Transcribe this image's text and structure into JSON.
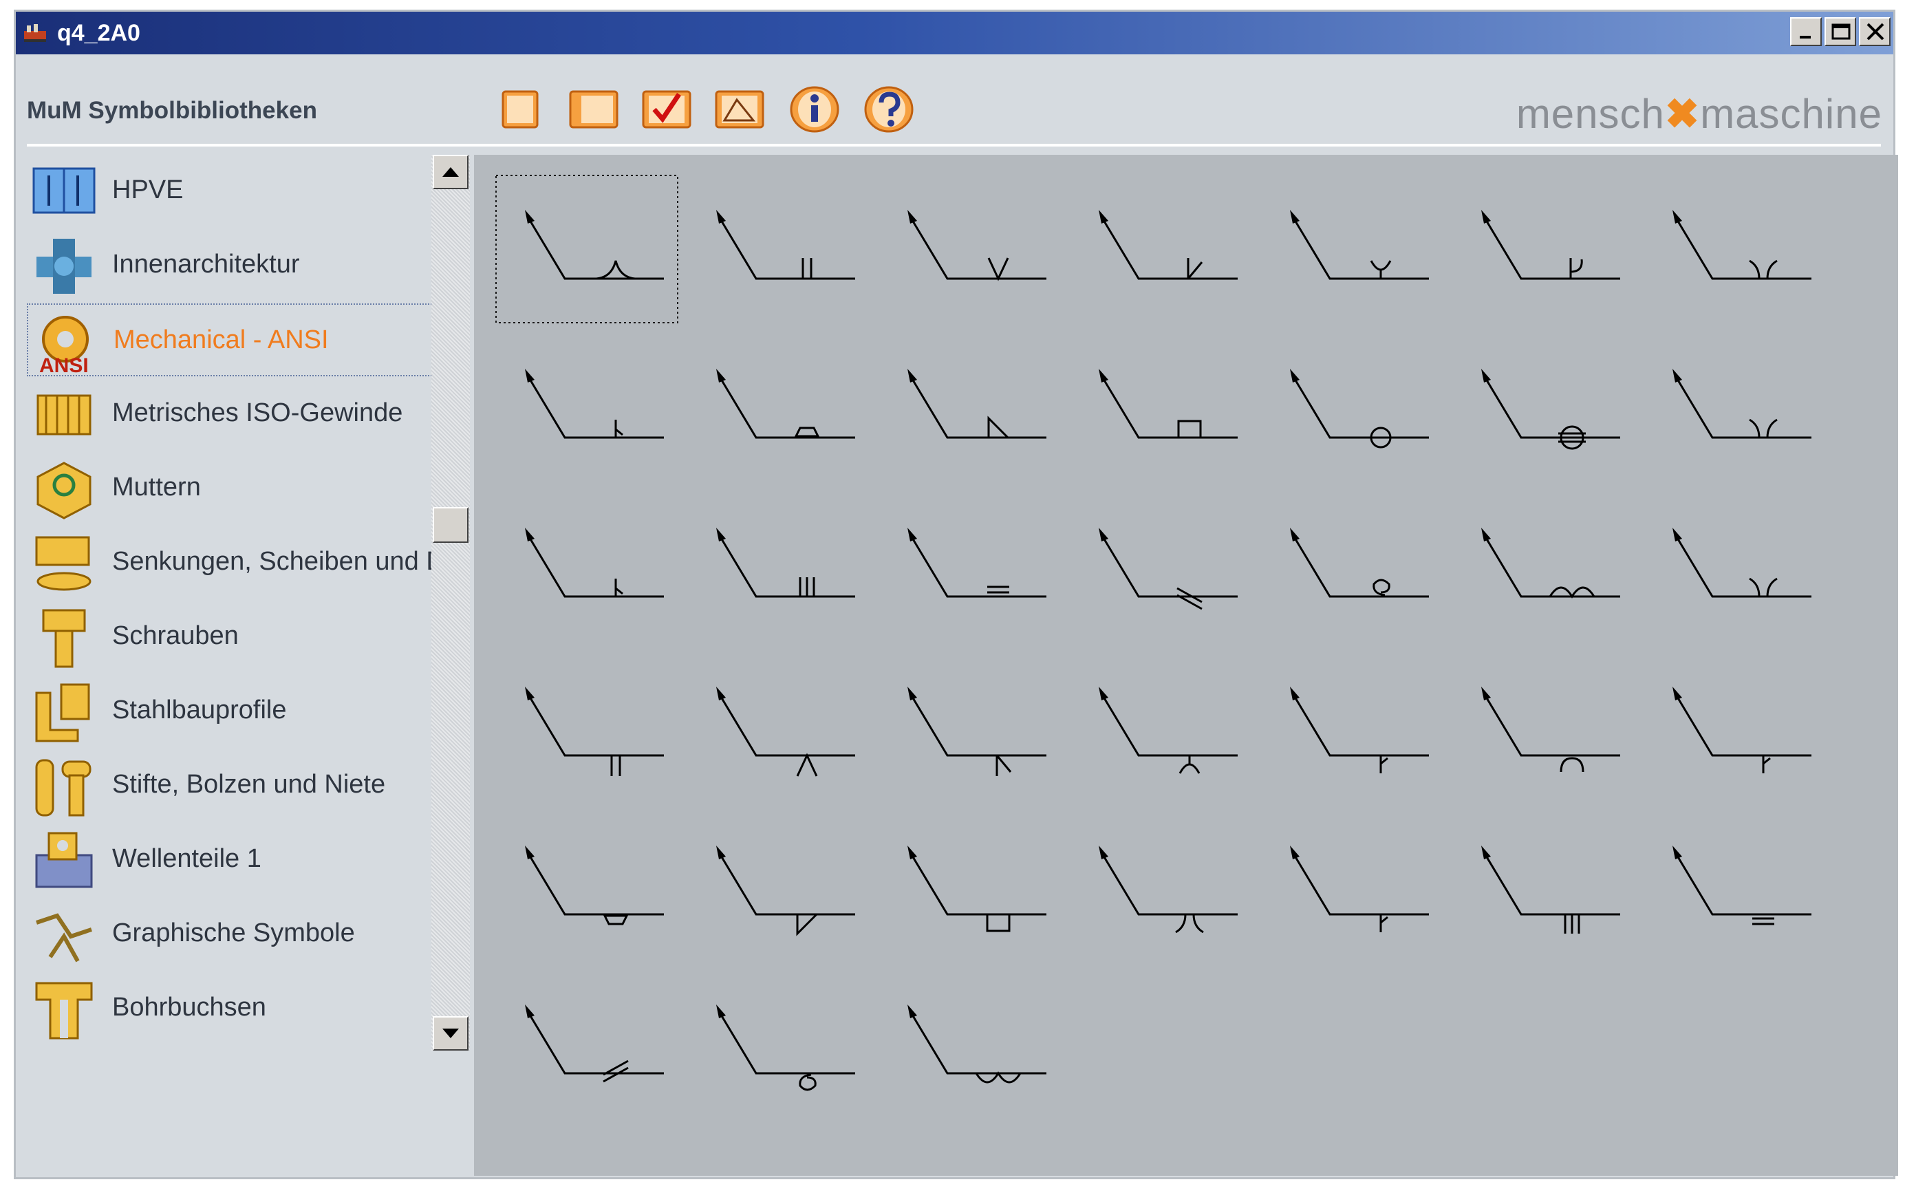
{
  "window": {
    "title": "q4_2A0",
    "controls": [
      "minimize",
      "maximize",
      "close"
    ]
  },
  "header": {
    "label": "MuM Symbolbibliotheken",
    "toolbar": [
      {
        "name": "new-icon",
        "color": "#f6a040"
      },
      {
        "name": "panel-icon",
        "color": "#f6a040"
      },
      {
        "name": "check-icon",
        "color": "#f6a040"
      },
      {
        "name": "edit-shape-icon",
        "color": "#f6a040"
      },
      {
        "name": "info-icon",
        "color": "#f6a040"
      },
      {
        "name": "help-icon",
        "color": "#f6a040"
      }
    ],
    "brand_left": "mensch",
    "brand_mid": "✖",
    "brand_right": "maschine"
  },
  "sidebar": {
    "items": [
      {
        "label": "HPVE",
        "icon": "hpve-icon"
      },
      {
        "label": "Innenarchitektur",
        "icon": "interior-icon"
      },
      {
        "label": "Mechanical - ANSI",
        "icon": "gear-ansi-icon",
        "selected": true,
        "badge": "ANSI"
      },
      {
        "label": "Metrisches ISO-Gewinde",
        "icon": "thread-icon"
      },
      {
        "label": "Muttern",
        "icon": "nut-icon"
      },
      {
        "label": "Senkungen, Scheiben und Du",
        "icon": "washer-icon"
      },
      {
        "label": "Schrauben",
        "icon": "screw-icon"
      },
      {
        "label": "Stahlbauprofile",
        "icon": "steel-profile-icon"
      },
      {
        "label": "Stifte, Bolzen und Niete",
        "icon": "pin-icon"
      },
      {
        "label": "Wellenteile 1",
        "icon": "shaft-icon"
      },
      {
        "label": "Graphische Symbole",
        "icon": "graphic-symbol-icon"
      },
      {
        "label": "Bohrbuchsen",
        "icon": "bushing-icon"
      }
    ]
  },
  "grid": {
    "symbol_count": 38,
    "selected_index": 0,
    "symbols": [
      "flare-bevel",
      "square-groove",
      "v-groove",
      "bevel-groove",
      "u-groove",
      "j-groove",
      "flare-v",
      "j-groove-2",
      "backing-spacer",
      "fillet",
      "square-plug",
      "spot",
      "seam",
      "flare-v-2",
      "j-mark",
      "triple-line",
      "double-line",
      "slash",
      "spiral",
      "double-arc",
      "flare-below",
      "square-groove-below",
      "v-below",
      "bevel-below",
      "u-below",
      "j-below",
      "arc-below",
      "j-below-2",
      "backing-below",
      "fillet-below",
      "plug-below",
      "flare-v-below",
      "j-mark-below",
      "triple-below",
      "double-line-below",
      "slash-below",
      "spiral-below",
      "double-arc-below"
    ],
    "line_color": "#000000"
  }
}
